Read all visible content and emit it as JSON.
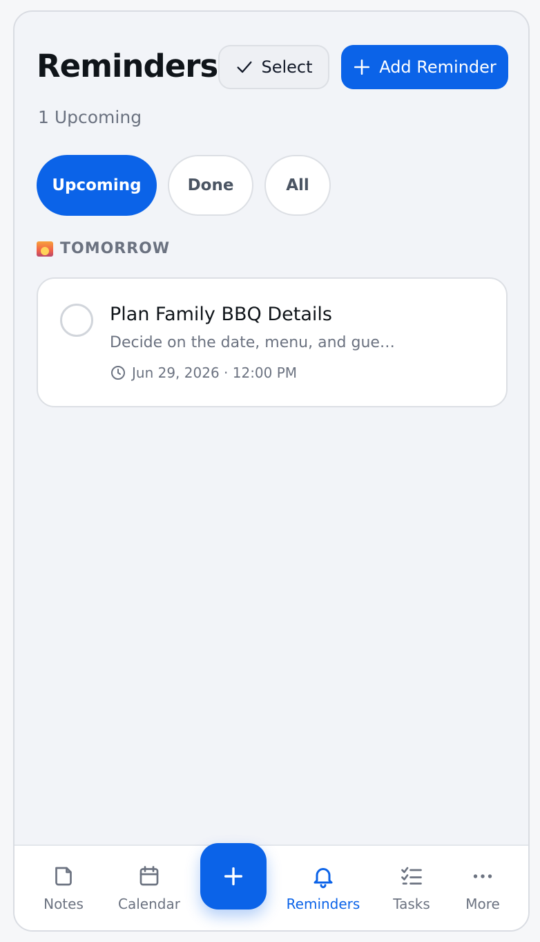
{
  "header": {
    "title": "Reminders",
    "subtitle": "1 Upcoming",
    "select_label": "Select",
    "add_label": "Add Reminder"
  },
  "filters": [
    {
      "label": "Upcoming",
      "active": true
    },
    {
      "label": "Done",
      "active": false
    },
    {
      "label": "All",
      "active": false
    }
  ],
  "section": {
    "icon": "sunrise-icon",
    "label": "TOMORROW"
  },
  "reminders": [
    {
      "title": "Plan Family BBQ Details",
      "description": "Decide on the date, menu, and gue…",
      "datetime": "Jun 29, 2026 · 12:00 PM",
      "completed": false
    }
  ],
  "tabbar": {
    "notes": "Notes",
    "calendar": "Calendar",
    "reminders": "Reminders",
    "tasks": "Tasks",
    "more": "More",
    "active": "reminders"
  },
  "colors": {
    "accent": "#0b63e8",
    "background": "#f2f4f8",
    "muted_text": "#6b7280"
  }
}
